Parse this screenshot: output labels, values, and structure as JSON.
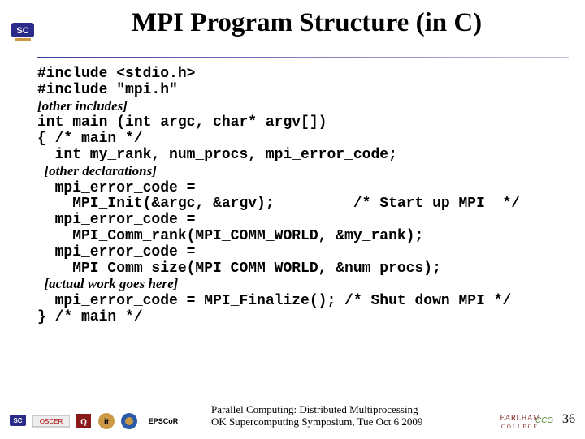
{
  "title": "MPI Program Structure (in C)",
  "code": {
    "l1": "#include <stdio.h>",
    "l2": "#include \"mpi.h\"",
    "l3": "[other includes]",
    "l4": "int main (int argc, char* argv[])",
    "l5": "{ /* main */",
    "l6": "  int my_rank, num_procs, mpi_error_code;",
    "l7": "  [other declarations]",
    "l8": "  mpi_error_code =",
    "l9": "    MPI_Init(&argc, &argv);         /* Start up MPI  */",
    "l10": "  mpi_error_code =",
    "l11": "    MPI_Comm_rank(MPI_COMM_WORLD, &my_rank);",
    "l12": "  mpi_error_code =",
    "l13": "    MPI_Comm_size(MPI_COMM_WORLD, &num_procs);",
    "l14": "  [actual work goes here]",
    "l15": "  mpi_error_code = MPI_Finalize(); /* Shut down MPI */",
    "l16": "} /* main */"
  },
  "chart_data": {
    "type": "table",
    "title": "MPI Program Structure (in C)",
    "code_lines": [
      "#include <stdio.h>",
      "#include \"mpi.h\"",
      "[other includes]",
      "int main (int argc, char* argv[])",
      "{ /* main */",
      "  int my_rank, num_procs, mpi_error_code;",
      "  [other declarations]",
      "  mpi_error_code =",
      "    MPI_Init(&argc, &argv);         /* Start up MPI  */",
      "  mpi_error_code =",
      "    MPI_Comm_rank(MPI_COMM_WORLD, &my_rank);",
      "  mpi_error_code =",
      "    MPI_Comm_size(MPI_COMM_WORLD, &num_procs);",
      "  [actual work goes here]",
      "  mpi_error_code = MPI_Finalize(); /* Shut down MPI */",
      "} /* main */"
    ]
  },
  "footer": {
    "line1": "Parallel Computing: Distributed Multiprocessing",
    "line2": "OK Supercomputing Symposium, Tue Oct 6 2009"
  },
  "page_number": "36",
  "logos": {
    "sc": "SC",
    "oscer": "OSCER",
    "ou": "OU",
    "it": "it",
    "epscor": "EPSCoR",
    "earlham": "EARLHAM COLLEGE",
    "ccg": "CCG"
  }
}
